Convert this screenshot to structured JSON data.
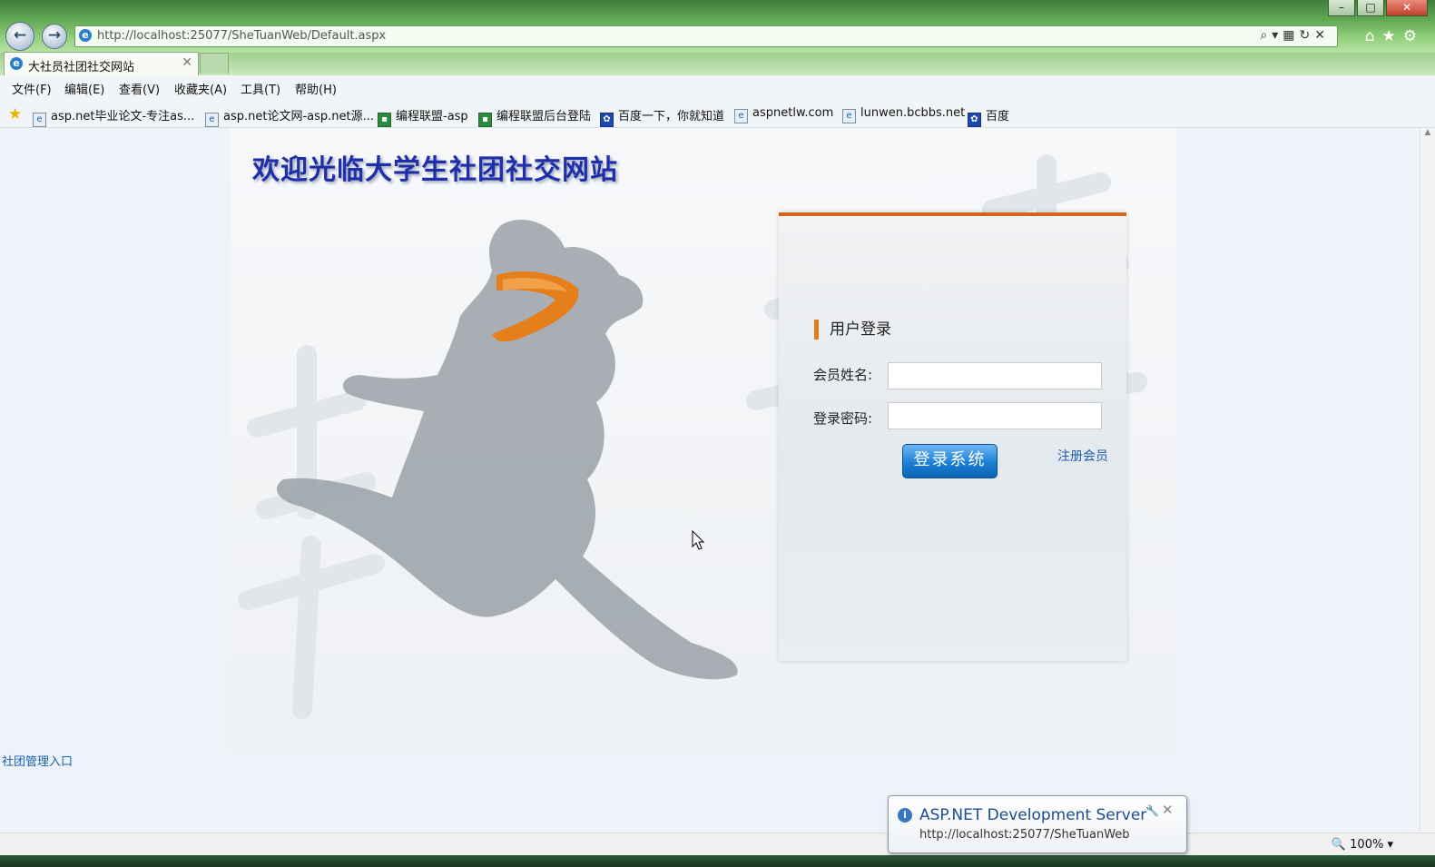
{
  "window": {
    "controls": [
      "–",
      "□",
      "✕"
    ]
  },
  "browser": {
    "address": "http://localhost:25077/SheTuanWeb/Default.aspx",
    "tab_title": "大社员社团社交网站",
    "menu": [
      "文件(F)",
      "编辑(E)",
      "查看(V)",
      "收藏夹(A)",
      "工具(T)",
      "帮助(H)"
    ],
    "favorites": [
      {
        "label": "asp.net毕业论文-专注as...",
        "icon": "ie-page-icon"
      },
      {
        "label": "asp.net论文网-asp.net源...",
        "icon": "ie-page-icon"
      },
      {
        "label": "编程联盟-asp",
        "icon": "green-site-icon"
      },
      {
        "label": "编程联盟后台登陆",
        "icon": "green-site-icon"
      },
      {
        "label": "百度一下，你就知道",
        "icon": "baidu-paw-icon"
      },
      {
        "label": "aspnetlw.com",
        "icon": "ie-page-icon"
      },
      {
        "label": "lunwen.bcbbs.net",
        "icon": "ie-page-icon"
      },
      {
        "label": "百度",
        "icon": "baidu-paw-icon"
      }
    ],
    "zoom": "100%"
  },
  "page": {
    "site_title": "欢迎光临大学生社团社交网站",
    "login": {
      "heading": "用户登录",
      "username_label": "会员姓名:",
      "username_value": "",
      "password_label": "登录密码:",
      "password_value": "",
      "submit_label": "登录系统",
      "register_link": "注册会员"
    },
    "admin_link": "社团管理入口"
  },
  "notification": {
    "title": "ASP.NET Development Server",
    "url": "http://localhost:25077/SheTuanWeb"
  },
  "colors": {
    "accent_orange": "#d4661b",
    "title_blue": "#1f2fa8",
    "button_blue": "#1a7fd6",
    "link_blue": "#1b5fae"
  }
}
